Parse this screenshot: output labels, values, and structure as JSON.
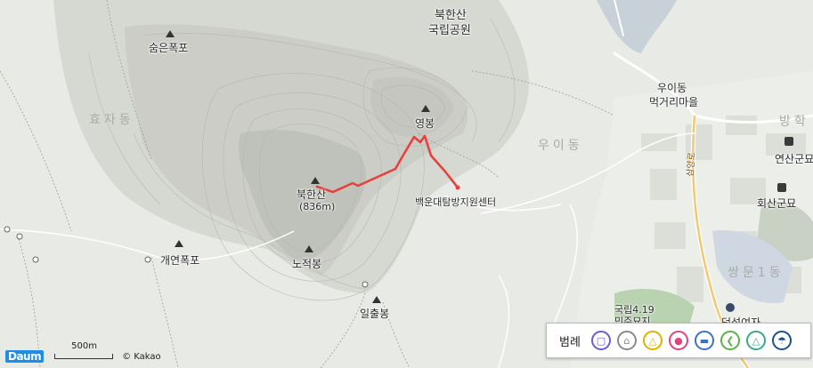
{
  "map": {
    "labels": {
      "bukhansan_park_line1": "북한산",
      "bukhansan_park_line2": "국립공원",
      "sumeun_falls": "숨은폭포",
      "hyoja_dong": "효자동",
      "yeongbong": "영봉",
      "uiidong_village_line1": "우이동",
      "uiidong_village_line2": "먹거리마을",
      "uidong_area": "우이동",
      "bang_area": "방학",
      "yeonsan_tomb": "연산군묘",
      "hoesan_tomb": "회산군묘",
      "baegundae_center": "백운대탐방지원센터",
      "bukhansan_peak": "북한산",
      "bukhansan_elev": "(836m)",
      "gaeyeon_falls": "개연폭포",
      "nojeokbong": "노적봉",
      "ilchulbong": "일출봉",
      "ssangmun_area": "쌍문1동",
      "samyang_road": "삼양로",
      "national_419_line1": "국립4.19",
      "national_419_line2": "민주묘지",
      "duksung_univ": "덕성여자"
    },
    "route_color": "#e8403c",
    "legend": {
      "title": "범례",
      "items": [
        {
          "icon": "bus-icon",
          "color": "#6a5bd6"
        },
        {
          "icon": "house-icon",
          "color": "#8a8a8a"
        },
        {
          "icon": "warning-icon",
          "color": "#e2b100"
        },
        {
          "icon": "person-icon",
          "color": "#e0457b"
        },
        {
          "icon": "car-icon",
          "color": "#3d73c6"
        },
        {
          "icon": "share-icon",
          "color": "#5ab04a"
        },
        {
          "icon": "bottle-icon",
          "color": "#3aa98a"
        },
        {
          "icon": "umbrella-icon",
          "color": "#1d4e8f"
        }
      ]
    },
    "scale": {
      "logo": "Daum",
      "distance": "500m",
      "copyright": "© Kakao"
    }
  }
}
